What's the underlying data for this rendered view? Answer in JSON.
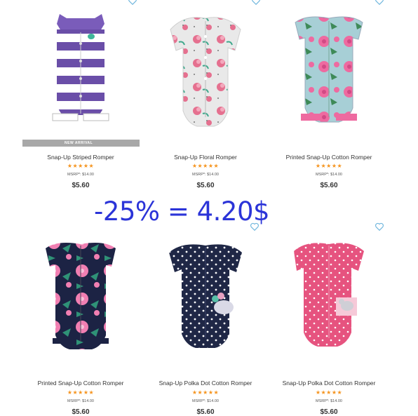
{
  "promo_text": "-25% = 4.20$",
  "products": [
    {
      "title": "Snap-Up Striped Romper",
      "stars": "★★★★★",
      "msrp": "MSRP*: $14.00",
      "price": "$5.60",
      "badge": "NEW ARRIVAL"
    },
    {
      "title": "Snap-Up Floral Romper",
      "stars": "★★★★★",
      "msrp": "MSRP*: $14.00",
      "price": "$5.60"
    },
    {
      "title": "Printed Snap-Up Cotton Romper",
      "stars": "★★★★★",
      "msrp": "MSRP*: $14.00",
      "price": "$5.60"
    },
    {
      "title": "Printed Snap-Up Cotton Romper",
      "stars": "★★★★★",
      "msrp": "MSRP*: $14.00",
      "price": "$5.60"
    },
    {
      "title": "Snap-Up Polka Dot Cotton Romper",
      "stars": "★★★★★",
      "msrp": "MSRP*: $14.00",
      "price": "$5.60"
    },
    {
      "title": "Snap-Up Polka Dot Cotton Romper",
      "stars": "★★★★★",
      "msrp": "MSRP*: $14.00",
      "price": "$5.60"
    }
  ],
  "colors": {
    "star": "#f5941e",
    "promo": "#2b34d8",
    "favorite_icon": "#6fb6dd",
    "badge_bg": "#a8a8a8"
  }
}
